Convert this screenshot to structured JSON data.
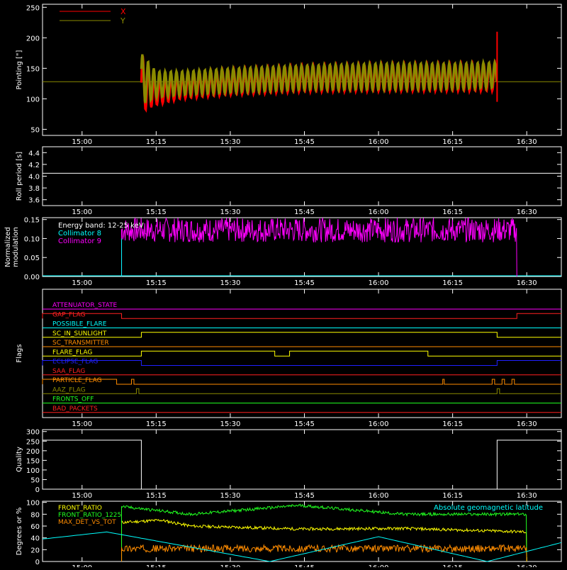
{
  "chart_data": [
    {
      "type": "line",
      "ylabel": "Pointing [\"]",
      "yticks": [
        50,
        100,
        150,
        200,
        250
      ],
      "ylim": [
        40,
        255
      ],
      "xlim": [
        "14:52",
        "16:37"
      ],
      "xtick_labels": [
        "15:00",
        "15:15",
        "15:30",
        "15:45",
        "16:00",
        "16:15",
        "16:30"
      ],
      "legend": "top-left",
      "series": [
        {
          "name": "X",
          "color": "#ff0000",
          "t_start": "15:12",
          "t_end": "16:24",
          "x": [
            "15:12",
            "15:15",
            "15:20",
            "15:30",
            "15:45",
            "16:00",
            "16:15",
            "16:24"
          ],
          "upper": [
            175,
            130,
            140,
            148,
            154,
            156,
            157,
            158
          ],
          "lower": [
            78,
            90,
            100,
            107,
            112,
            113,
            113,
            113
          ]
        },
        {
          "name": "Y",
          "color": "#8b8b00",
          "t_start": "15:12",
          "t_end": "16:24",
          "x": [
            "15:12",
            "15:15",
            "15:20",
            "15:30",
            "15:45",
            "16:00",
            "16:15",
            "16:24"
          ],
          "upper": [
            175,
            145,
            145,
            150,
            155,
            158,
            158,
            160
          ],
          "lower": [
            90,
            102,
            106,
            110,
            115,
            115,
            116,
            118
          ]
        }
      ],
      "baseline": {
        "value": 128,
        "color": "#8b8b00"
      }
    },
    {
      "type": "line",
      "ylabel": "Roll period [s]",
      "yticks": [
        3.6,
        3.8,
        4.0,
        4.2,
        4.4
      ],
      "yticks_text": [
        "3.6",
        "3.8",
        "4.0",
        "4.2",
        "4.4"
      ],
      "ylim": [
        3.5,
        4.5
      ],
      "xtick_labels": [
        "15:00",
        "15:15",
        "15:30",
        "15:45",
        "16:00",
        "16:15",
        "16:30"
      ],
      "series": [
        {
          "name": "",
          "color": "#ffffff",
          "value": 4.05
        }
      ]
    },
    {
      "type": "line",
      "ylabel": "Normalized modulation",
      "ylabel_lines": [
        "Normalized",
        "modulation"
      ],
      "yticks": [
        0.0,
        0.05,
        0.1,
        0.15
      ],
      "yticks_text": [
        "0.00",
        "0.05",
        "0.10",
        "0.15"
      ],
      "ylim": [
        0,
        0.155
      ],
      "xtick_labels": [
        "15:00",
        "15:15",
        "15:30",
        "15:45",
        "16:00",
        "16:15",
        "16:30"
      ],
      "annotations": [
        {
          "text": "Energy band: 12-25 keV",
          "color": "#ffffff"
        },
        {
          "text": "Collimator 8",
          "color": "#00ffff"
        },
        {
          "text": "Collimator 9",
          "color": "#ff00ff"
        }
      ],
      "series": [
        {
          "name": "Collimator 8",
          "color": "#00ffff",
          "value": 0.0
        },
        {
          "name": "Collimator 9",
          "color": "#ff00ff",
          "t_start": "15:08",
          "t_end": "16:28",
          "typical": [
            0.09,
            0.155
          ]
        }
      ]
    },
    {
      "type": "line",
      "ylabel": "Flags",
      "xtick_labels": [
        "15:00",
        "15:15",
        "15:30",
        "15:45",
        "16:00",
        "16:15",
        "16:30"
      ],
      "flags": [
        {
          "name": "ATTENUATOR_STATE",
          "color": "#ff00ff",
          "steps": []
        },
        {
          "name": "GAP_FLAG",
          "color": "#ff2020",
          "steps": [
            [
              "14:52",
              1
            ],
            [
              "15:08",
              0
            ],
            [
              "16:28",
              1
            ]
          ]
        },
        {
          "name": "POSSIBLE_FLARE",
          "color": "#00ffff",
          "steps": []
        },
        {
          "name": "SC_IN_SUNLIGHT",
          "color": "#ffff00",
          "steps": [
            [
              "14:52",
              0
            ],
            [
              "15:12",
              1
            ],
            [
              "16:24",
              0
            ]
          ]
        },
        {
          "name": "SC_TRANSMITTER",
          "color": "#ff8c00",
          "steps": []
        },
        {
          "name": "FLARE_FLAG",
          "color": "#ffff00",
          "steps": [
            [
              "14:52",
              0
            ],
            [
              "15:12",
              1
            ],
            [
              "15:39",
              0
            ],
            [
              "15:42",
              1
            ],
            [
              "16:10",
              0
            ]
          ]
        },
        {
          "name": "ECLIPSE_FLAG",
          "color": "#2020ff",
          "steps": [
            [
              "14:52",
              1
            ],
            [
              "15:12",
              0
            ],
            [
              "16:24",
              1
            ]
          ]
        },
        {
          "name": "SAA_FLAG",
          "color": "#ff2020",
          "steps": []
        },
        {
          "name": "PARTICLE_FLAG",
          "color": "#ff8c00",
          "steps": [
            [
              "14:52",
              1
            ],
            [
              "15:07",
              0
            ],
            [
              "15:10",
              1
            ],
            [
              "15:10.5",
              0
            ],
            [
              "16:13",
              1
            ],
            [
              "16:13.3",
              0
            ],
            [
              "16:23",
              1
            ],
            [
              "16:23.5",
              0
            ],
            [
              "16:25",
              1
            ],
            [
              "16:25.5",
              0
            ],
            [
              "16:27",
              1
            ],
            [
              "16:27.5",
              0
            ]
          ]
        },
        {
          "name": "AAZ_FLAG",
          "color": "#8b8b00",
          "steps": [
            [
              "15:11",
              1
            ],
            [
              "15:11.5",
              0
            ],
            [
              "16:24",
              1
            ],
            [
              "16:24.5",
              0
            ]
          ]
        },
        {
          "name": "FRONTS_OFF",
          "color": "#20ff20",
          "steps": []
        },
        {
          "name": "BAD_PACKETS",
          "color": "#ff2020",
          "steps": []
        }
      ]
    },
    {
      "type": "line",
      "ylabel": "Quality",
      "yticks": [
        0,
        50,
        100,
        150,
        200,
        250,
        300
      ],
      "ylim": [
        0,
        310
      ],
      "xtick_labels": [
        "15:00",
        "15:15",
        "15:30",
        "15:45",
        "16:00",
        "16:15",
        "16:30"
      ],
      "series": [
        {
          "name": "",
          "color": "#ffffff",
          "steps": [
            [
              "14:52",
              255
            ],
            [
              "15:12",
              0
            ],
            [
              "16:24",
              255
            ]
          ]
        }
      ]
    },
    {
      "type": "line",
      "ylabel": "Degrees or %",
      "yticks": [
        0,
        20,
        40,
        60,
        80,
        100
      ],
      "ylim": [
        0,
        102
      ],
      "xtick_labels": [
        "15:00",
        "15:15",
        "15:30",
        "15:45",
        "16:00",
        "16:15",
        "16:30"
      ],
      "legend": "top-left",
      "right_annotation": {
        "text": "Absolute geomagnetic latitude",
        "color": "#00ffff"
      },
      "series": [
        {
          "name": "FRONT_RATIO",
          "color": "#ffff00",
          "x": [
            "15:08",
            "15:16",
            "15:22",
            "15:44",
            "16:05",
            "16:30"
          ],
          "values": [
            66,
            70,
            60,
            55,
            56,
            50
          ]
        },
        {
          "name": "FRONT_RATIO_1225",
          "color": "#20ff20",
          "x": [
            "15:08",
            "15:22",
            "15:44",
            "16:05",
            "16:30"
          ],
          "values": [
            93,
            80,
            95,
            80,
            80
          ]
        },
        {
          "name": "MAX_DET_VS_TOT",
          "color": "#ff8c00",
          "x": [
            "15:08",
            "16:30"
          ],
          "values": [
            22,
            22
          ]
        },
        {
          "name": "Absolute geomagnetic latitude",
          "color": "#00ffff",
          "x": [
            "14:52",
            "15:05",
            "15:38",
            "16:00",
            "16:22",
            "16:37"
          ],
          "values": [
            38,
            50,
            0,
            42,
            0,
            32
          ]
        }
      ]
    }
  ]
}
